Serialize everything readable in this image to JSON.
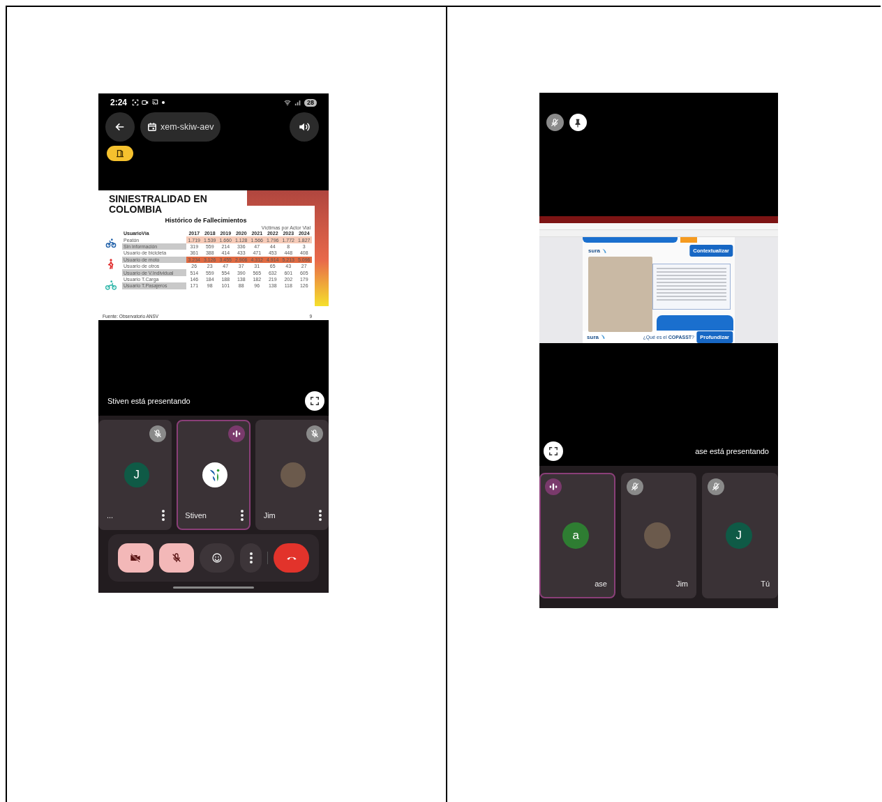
{
  "phones": [
    {
      "mirrored": false,
      "status_bar": {
        "time": "2:24",
        "battery": "28"
      },
      "meeting_code": "xem-skiw-aev",
      "slide": {
        "kind": "table_slide",
        "title": "SINIESTRALIDAD EN COLOMBIA",
        "subtitle": "Histórico de Fallecimientos",
        "caption": "Víctimas por Actor Vial",
        "columns": [
          "UsuarioVía",
          "2017",
          "2018",
          "2019",
          "2020",
          "2021",
          "2022",
          "2023",
          "2024"
        ],
        "rows": [
          {
            "shaded": false,
            "color": "#f6cbb8",
            "cells": [
              "Peatón",
              "1.719",
              "1.539",
              "1.660",
              "1.128",
              "1.566",
              "1.796",
              "1.772",
              "1.827"
            ]
          },
          {
            "shaded": true,
            "cells": [
              "Sin información",
              "319",
              "559",
              "214",
              "336",
              "47",
              "44",
              "8",
              "3"
            ]
          },
          {
            "shaded": false,
            "cells": [
              "Usuario de bicicleta",
              "361",
              "388",
              "414",
              "433",
              "471",
              "453",
              "448",
              "408"
            ]
          },
          {
            "shaded": true,
            "color": "#e06a42",
            "cells": [
              "Usuario de moto",
              "3.234",
              "3.126",
              "3.455",
              "2.906",
              "4.312",
              "4.914",
              "5.213",
              "5.096"
            ]
          },
          {
            "shaded": false,
            "cells": [
              "Usuario de otros",
              "26",
              "23",
              "47",
              "37",
              "31",
              "65",
              "43",
              "27"
            ]
          },
          {
            "shaded": true,
            "cells": [
              "Usuario de V.Individual",
              "514",
              "559",
              "554",
              "390",
              "565",
              "632",
              "601",
              "605"
            ]
          },
          {
            "shaded": false,
            "cells": [
              "Usuario T.Carga",
              "146",
              "184",
              "188",
              "138",
              "182",
              "219",
              "202",
              "179"
            ]
          },
          {
            "shaded": true,
            "cells": [
              "Usuario T.Pasajeros",
              "171",
              "98",
              "101",
              "88",
              "96",
              "138",
              "118",
              "126"
            ]
          }
        ],
        "source": "Fuente: Observatorio ANSV",
        "page": "9"
      },
      "presenting": "Stiven está presentando",
      "tiles": [
        {
          "name": "...",
          "kind": "initial",
          "initial": "J",
          "color": "#0f5a46",
          "muted": true,
          "selected": false,
          "menu": true
        },
        {
          "name": "Stiven",
          "kind": "logo",
          "muted": false,
          "selected": true,
          "menu": true
        },
        {
          "name": "Jim",
          "kind": "photo",
          "muted": true,
          "selected": false,
          "menu": true
        }
      ],
      "controls": [
        {
          "kind": "camera_off"
        },
        {
          "kind": "mic_off"
        },
        {
          "kind": "reaction"
        },
        {
          "kind": "more"
        },
        {
          "kind": "end_call"
        }
      ]
    },
    {
      "mirrored": true,
      "top_buttons": [
        {
          "kind": "mic_off"
        },
        {
          "kind": "pin"
        }
      ],
      "slide": {
        "kind": "browser_slide",
        "section_button": "Contextualizar",
        "top_logo": "sura",
        "bottom_button": "Profundizar",
        "question": "¿Qué es el **COPASST**?",
        "bottom_logo": "sura"
      },
      "presenting": "ase está presentando",
      "tiles": [
        {
          "name": "ase",
          "kind": "initial",
          "initial": "a",
          "color": "#2e7d32",
          "muted": false,
          "selected": true
        },
        {
          "name": "Jim",
          "kind": "photo",
          "muted": true,
          "selected": false
        },
        {
          "name": "Tú",
          "kind": "initial",
          "initial": "J",
          "color": "#0f5a46",
          "muted": true,
          "selected": false
        }
      ]
    }
  ]
}
